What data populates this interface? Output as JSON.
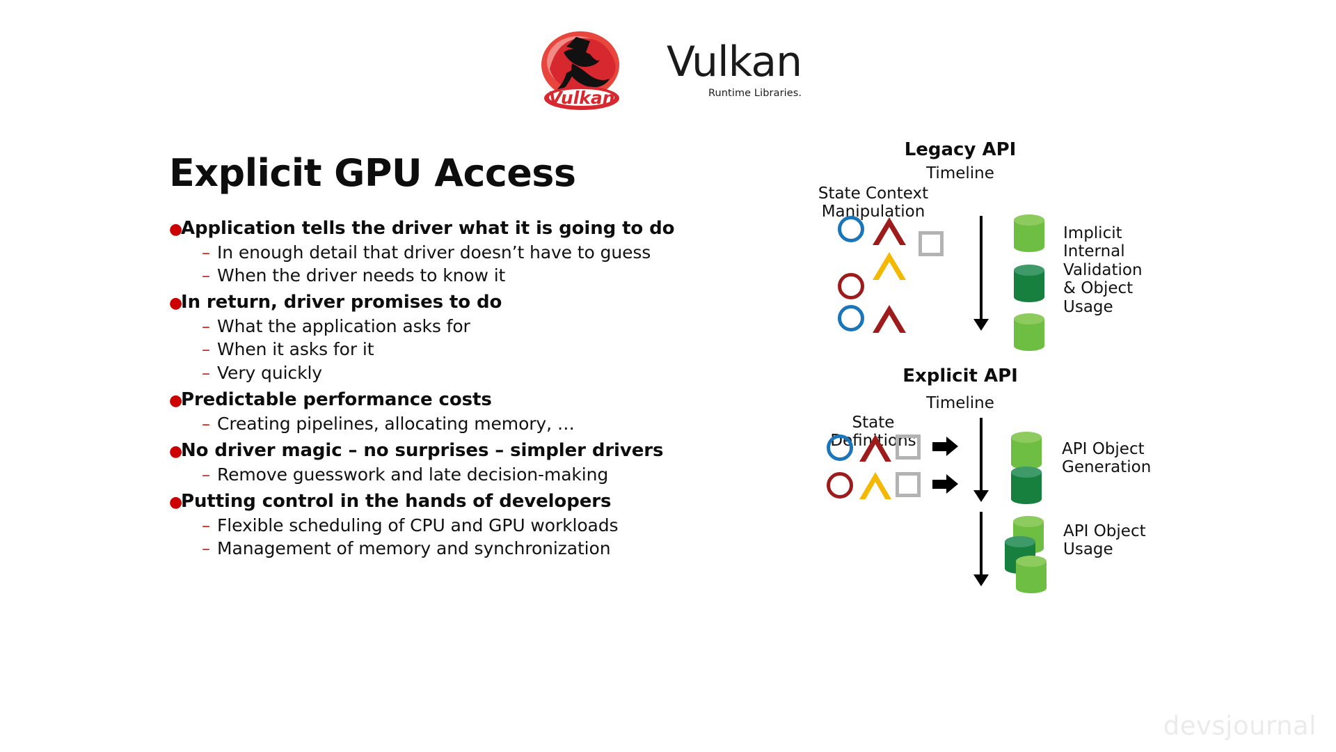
{
  "logo": {
    "wordmark": "Vulkan",
    "subtitle": "Runtime Libraries.",
    "mark_name": "vulkan-dragon-logo"
  },
  "slide": {
    "title": "Explicit GPU Access"
  },
  "bullets": [
    {
      "text": "Application tells the driver what it is going to do",
      "sub": [
        "In enough detail that driver doesn’t have to guess",
        "When the driver needs to know it"
      ]
    },
    {
      "text": "In return, driver promises to do",
      "sub": [
        "What the application asks for",
        "When it asks for it",
        "Very quickly"
      ]
    },
    {
      "text": "Predictable performance costs",
      "sub": [
        "Creating pipelines, allocating memory, …"
      ]
    },
    {
      "text": "No driver magic – no surprises – simpler drivers",
      "sub": [
        "Remove guesswork and late decision-making"
      ]
    },
    {
      "text": "Putting control in the hands of developers",
      "sub": [
        "Flexible scheduling of CPU and GPU workloads",
        "Management of memory and synchronization"
      ]
    }
  ],
  "diagram": {
    "legacy": {
      "title": "Legacy API",
      "timeline_label": "Timeline",
      "state_label_line1": "State Context",
      "state_label_line2": "Manipulation",
      "side_label_lines": [
        "Implicit",
        "Internal",
        "Validation",
        "& Object",
        "Usage"
      ],
      "shapes": [
        {
          "kind": "circle",
          "color": "#1b75bb"
        },
        {
          "kind": "triangle",
          "color": "#9e1b1b"
        },
        {
          "kind": "square",
          "color": "#b3b3b3"
        },
        {
          "kind": "triangle",
          "color": "#f5b800"
        },
        {
          "kind": "circle",
          "color": "#9e1b1b"
        },
        {
          "kind": "circle",
          "color": "#1b75bb"
        },
        {
          "kind": "triangle",
          "color": "#9e1b1b"
        }
      ],
      "cylinders": [
        "light-green",
        "dark-green",
        "light-green"
      ]
    },
    "explicit": {
      "title": "Explicit API",
      "timeline_label": "Timeline",
      "state_label_line1": "State",
      "state_label_line2": "Definitions",
      "side_label_generation_lines": [
        "API Object",
        "Generation"
      ],
      "side_label_usage_lines": [
        "API Object",
        "Usage"
      ],
      "rows": [
        {
          "circle": "#1b75bb",
          "triangle": "#9e1b1b",
          "square": "#b3b3b3"
        },
        {
          "circle": "#9e1b1b",
          "triangle": "#f5b800",
          "square": "#b3b3b3"
        }
      ],
      "generation_cylinders": [
        "light-green",
        "dark-green"
      ],
      "usage_cylinders": [
        "light-green",
        "dark-green",
        "light-green"
      ]
    }
  },
  "watermark": "devsjournal",
  "colors": {
    "bullet_red": "#cc0000",
    "light_green": "#6fbe44",
    "light_green_top": "#8dcb5f",
    "dark_green": "#17803f",
    "dark_green_top": "#3e9a68",
    "blue": "#1b75bb",
    "dark_red": "#9e1b1b",
    "gold": "#f5b800",
    "gray": "#b3b3b3"
  }
}
